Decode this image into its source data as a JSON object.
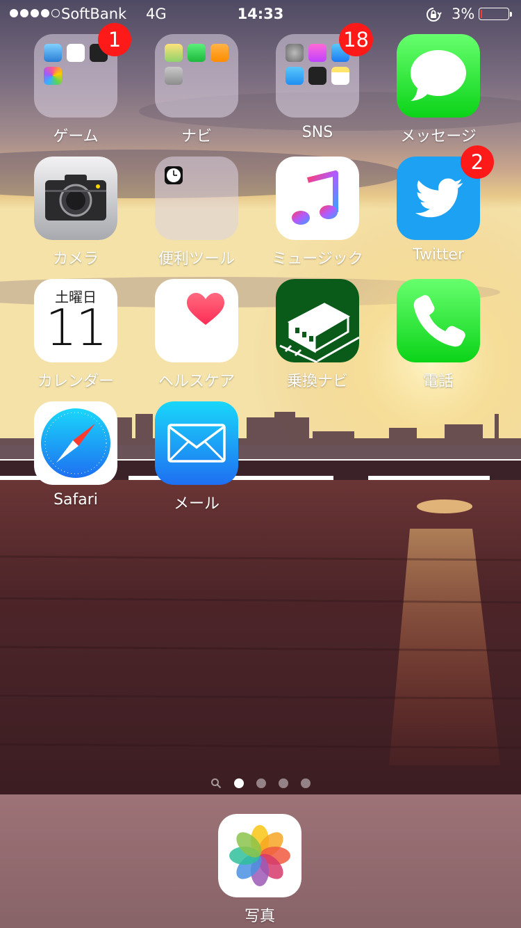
{
  "status_bar": {
    "carrier": "SoftBank",
    "network": "4G",
    "time": "14:33",
    "battery_percent": "3%",
    "battery_level": 0.03,
    "signal_bars_filled": 4,
    "signal_bars_total": 5
  },
  "apps": {
    "game_folder": {
      "label": "ゲーム",
      "badge": "1"
    },
    "navi_folder": {
      "label": "ナビ"
    },
    "sns_folder": {
      "label": "SNS",
      "badge": "18"
    },
    "messages": {
      "label": "メッセージ"
    },
    "camera": {
      "label": "カメラ"
    },
    "tools_folder": {
      "label": "便利ツール"
    },
    "music": {
      "label": "ミュージック"
    },
    "twitter": {
      "label": "Twitter",
      "badge": "2"
    },
    "calendar": {
      "label": "カレンダー",
      "weekday": "土曜日",
      "day": "11"
    },
    "health": {
      "label": "ヘルスケア"
    },
    "norikae": {
      "label": "乗換ナビ"
    },
    "phone": {
      "label": "電話"
    },
    "safari": {
      "label": "Safari"
    },
    "mail": {
      "label": "メール"
    }
  },
  "dock": {
    "photos": {
      "label": "写真"
    }
  },
  "page_indicator": {
    "pages": 4,
    "current": 1
  },
  "colors": {
    "badge": "#ff1a1a",
    "messages_green": "#4cd964",
    "twitter_blue": "#1da1f2",
    "norikae_green": "#0a5b1a"
  }
}
